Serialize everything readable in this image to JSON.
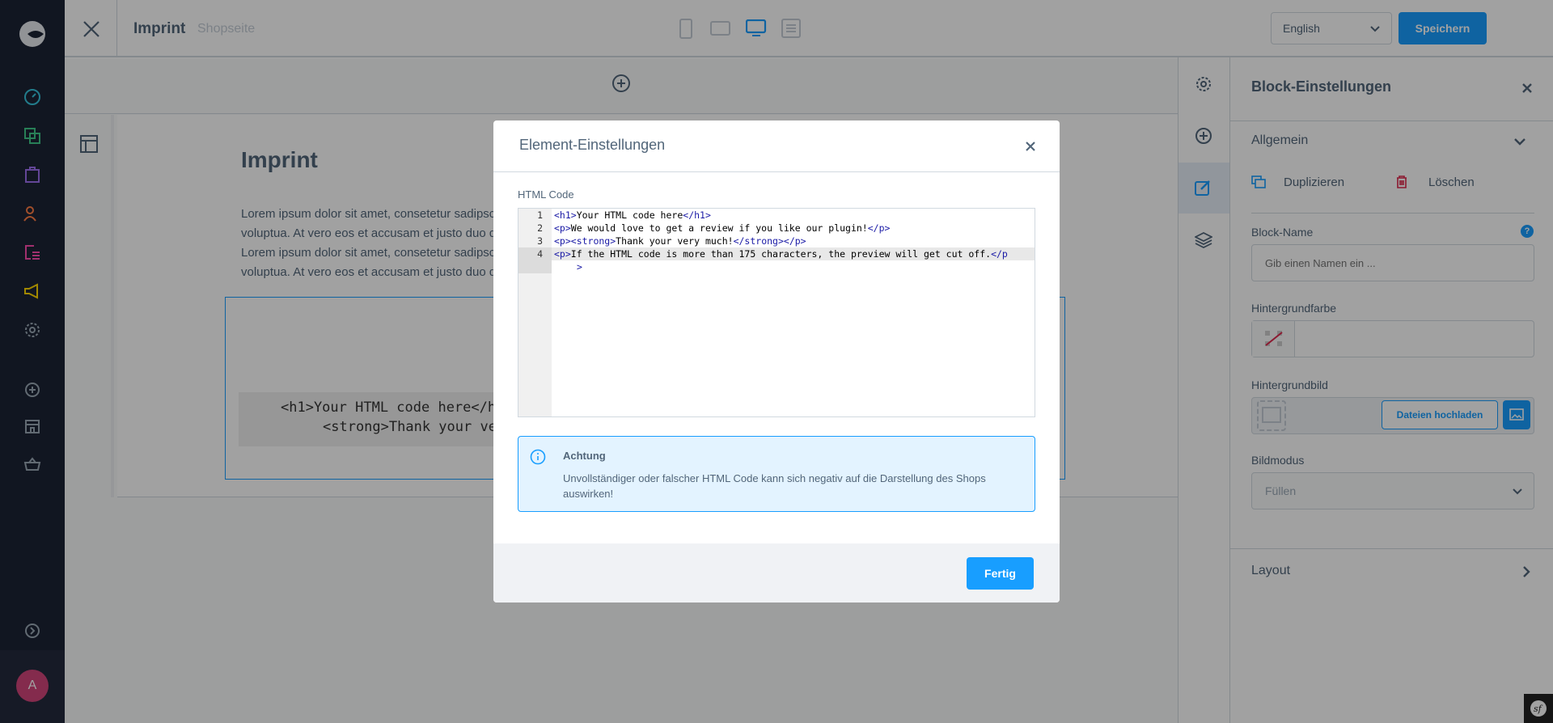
{
  "topbar": {
    "title": "Imprint",
    "subtitle": "Shopseite",
    "language": "English",
    "save_label": "Speichern",
    "devices": [
      "mobile-icon",
      "tablet-icon",
      "desktop-icon",
      "list-icon"
    ],
    "active_device": "desktop"
  },
  "sidebar": {
    "icons": [
      "dashboard-icon",
      "catalog-icon",
      "orders-icon",
      "customers-icon",
      "content-icon",
      "marketing-icon",
      "settings-icon",
      "add-extension-icon",
      "sales-channel-icon",
      "basket-icon",
      "collapse-icon"
    ],
    "avatar_initial": "A"
  },
  "canvas": {
    "heading": "Imprint",
    "paragraph_lines": [
      "Lorem ipsum dolor sit amet, consetetur sadipsc",
      "voluptua. At vero eos et accusam et justo duo d",
      "Lorem ipsum dolor sit amet, consetetur sadipsc",
      "voluptua. At vero eos et accusam et justo duo d"
    ],
    "html_preview_lines": [
      "<h1>Your HTML code here</h1",
      "<strong>Thank your ver"
    ]
  },
  "panel": {
    "title": "Block-Einstellungen",
    "section_general": "Allgemein",
    "duplicate": "Duplizieren",
    "delete": "Löschen",
    "block_name_label": "Block-Name",
    "block_name_placeholder": "Gib einen Namen ein ...",
    "bg_color_label": "Hintergrundfarbe",
    "bg_image_label": "Hintergrundbild",
    "upload_label": "Dateien hochladen",
    "image_mode_label": "Bildmodus",
    "image_mode_value": "Füllen",
    "section_layout": "Layout"
  },
  "modal": {
    "title": "Element-Einstellungen",
    "code_label": "HTML Code",
    "code_lines": [
      {
        "n": "1",
        "parts": [
          [
            "t",
            "<h1>"
          ],
          [
            "x",
            "Your HTML code here"
          ],
          [
            "t",
            "</h1>"
          ]
        ]
      },
      {
        "n": "2",
        "parts": [
          [
            "t",
            "<p>"
          ],
          [
            "x",
            "We would love to get a review if you like our plugin!"
          ],
          [
            "t",
            "</p>"
          ]
        ]
      },
      {
        "n": "3",
        "parts": [
          [
            "t",
            "<p><strong>"
          ],
          [
            "x",
            "Thank your very much!"
          ],
          [
            "t",
            "</strong></p>"
          ]
        ]
      },
      {
        "n": "4",
        "parts": [
          [
            "t",
            "<p>"
          ],
          [
            "x",
            "If the HTML code is more than 175 characters, the preview will get cut off."
          ],
          [
            "t",
            "</p"
          ]
        ],
        "wrap": ">"
      }
    ],
    "alert_title": "Achtung",
    "alert_text": "Unvollständiger oder falscher HTML Code kann sich negativ auf die Darstellung des Shops auswirken!",
    "done_label": "Fertig"
  },
  "colors": {
    "primary": "#189eff",
    "sidebar": "#1c2335",
    "alert_bg": "#e3f3ff",
    "alert_border": "#189eff"
  }
}
